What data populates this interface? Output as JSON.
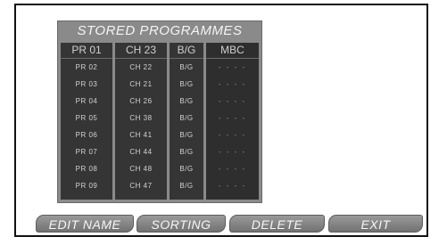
{
  "title": "STORED PROGRAMMES",
  "columns": [
    "PR 01",
    "CH 23",
    "B/G",
    "MBC"
  ],
  "rows": [
    [
      "PR 02",
      "CH 22",
      "B/G",
      "- - - -"
    ],
    [
      "PR 03",
      "CH 21",
      "B/G",
      "- - - -"
    ],
    [
      "PR 04",
      "CH 26",
      "B/G",
      "- - - -"
    ],
    [
      "PR 05",
      "CH 38",
      "B/G",
      "- - - -"
    ],
    [
      "PR 06",
      "CH 41",
      "B/G",
      "- - - -"
    ],
    [
      "PR 07",
      "CH 44",
      "B/G",
      "- - - -"
    ],
    [
      "PR 08",
      "CH 48",
      "B/G",
      "- - - -"
    ],
    [
      "PR 09",
      "CH 47",
      "B/G",
      "- - - -"
    ]
  ],
  "buttons": {
    "edit_name": "EDIT NAME",
    "sorting": "SORTING",
    "delete": "DELETE",
    "exit": "EXIT"
  }
}
